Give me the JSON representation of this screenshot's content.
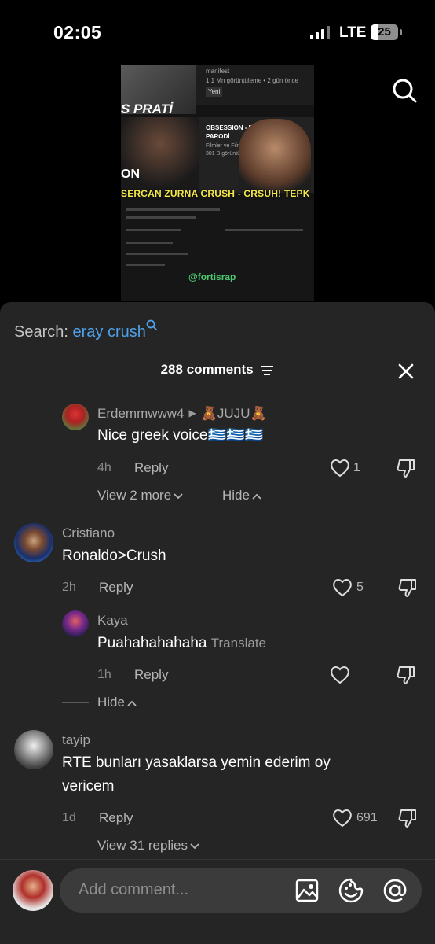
{
  "status": {
    "time": "02:05",
    "network": "LTE",
    "battery": "25",
    "battery_level": 0.25
  },
  "video": {
    "channel": "manifest",
    "views": "1,1 Mn görüntüleme • 2 gün önce",
    "badge": "Yeni",
    "pratik": "S PRATİ",
    "obsession_title": "OBSESSION - E",
    "obsession_sub": "PARODİ",
    "obsession_meta1": "Filmler ve Filmle",
    "obsession_meta2": "301 B görüntü",
    "on_text": "ON",
    "banner": "SERCAN ZURNA CRUSH - CRSUH! TEPK",
    "watermark": "@fortisrap"
  },
  "search": {
    "label": "Search:",
    "term": "eray crush"
  },
  "header": {
    "count": "288 comments"
  },
  "comments": [
    {
      "name": "Erdemmwww4",
      "reply_to": "🧸JUJU🧸",
      "text": "Nice greek voice🇬🇷🇬🇷🇬🇷",
      "time": "4h",
      "reply": "Reply",
      "likes": "1",
      "view_more": "View 2 more",
      "hide": "Hide"
    },
    {
      "name": "Cristiano",
      "text": "Ronaldo>Crush",
      "time": "2h",
      "reply": "Reply",
      "likes": "5"
    },
    {
      "name": "Kaya",
      "text": "Puahahahahaha",
      "translate": "Translate",
      "time": "1h",
      "reply": "Reply",
      "likes": "",
      "hide": "Hide"
    },
    {
      "name": "tayip",
      "text_line1": "RTE bunları yasaklarsa yemin ederim oy",
      "text_line2": "vericem",
      "time": "1d",
      "reply": "Reply",
      "likes": "691",
      "view_replies": "View 31 replies"
    }
  ],
  "input": {
    "placeholder": "Add comment..."
  },
  "colors": {
    "accent_link": "#4ea1ea",
    "sheet_bg": "#252525",
    "input_bg": "#3b3b3b"
  }
}
